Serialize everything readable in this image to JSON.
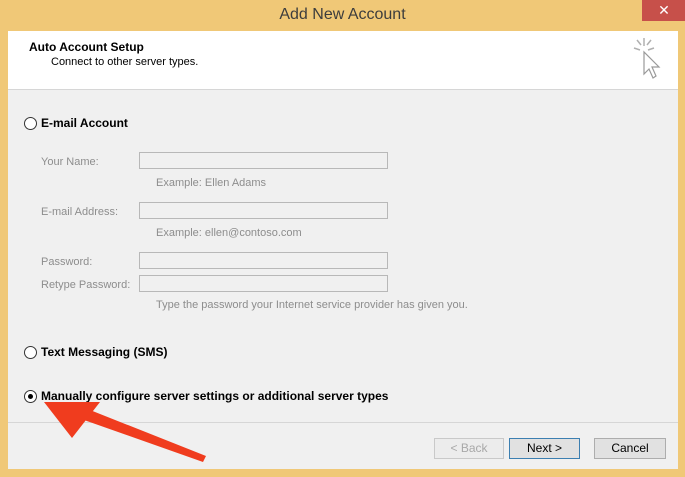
{
  "window": {
    "title": "Add New Account",
    "close_glyph": "✕"
  },
  "header": {
    "title": "Auto Account Setup",
    "subtitle": "Connect to other server types."
  },
  "options": {
    "email": {
      "label": "E-mail Account",
      "checked": false
    },
    "sms": {
      "label": "Text Messaging (SMS)",
      "checked": false
    },
    "manual": {
      "label": "Manually configure server settings or additional server types",
      "checked": true
    }
  },
  "fields": {
    "name": {
      "label": "Your Name:",
      "value": "",
      "hint": "Example: Ellen Adams"
    },
    "email": {
      "label": "E-mail Address:",
      "value": "",
      "hint": "Example: ellen@contoso.com"
    },
    "password": {
      "label": "Password:",
      "value": ""
    },
    "retype": {
      "label": "Retype Password:",
      "value": "",
      "hint": "Type the password your Internet service provider has given you."
    }
  },
  "buttons": {
    "back": "< Back",
    "next": "Next >",
    "cancel": "Cancel"
  },
  "annotation": {
    "arrow_color": "#f03c1e"
  }
}
